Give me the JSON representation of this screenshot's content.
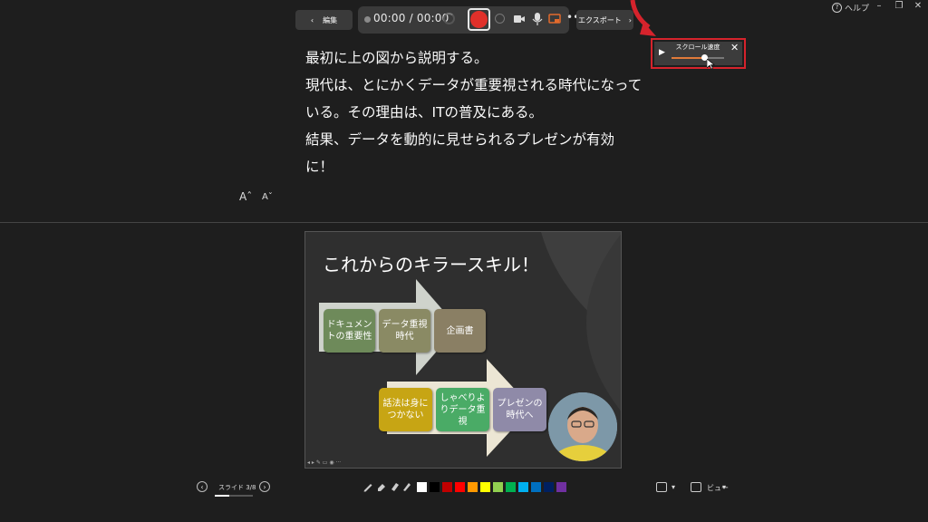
{
  "window": {
    "help_label": "ヘルプ",
    "minimize": "–",
    "restore": "❐",
    "close": "✕"
  },
  "toolbar": {
    "edit_label": "編集",
    "timer": "00:00 / 00:00",
    "export_label": "エクスポート",
    "more": "•••"
  },
  "script": {
    "lines": [
      "最初に上の図から説明する。",
      "現代は、とにかくデータが重要視される時代になって",
      "いる。その理由は、ITの普及にある。",
      "結果、データを動的に見せられるプレゼンが有効",
      "に！"
    ],
    "font_increase": "Aˆ",
    "font_decrease": "Aˇ"
  },
  "scroll_speed": {
    "label": "スクロール速度",
    "play": "▶",
    "close": "✕",
    "level": 0.62,
    "highlight_color": "#d6232c"
  },
  "slide": {
    "title": "これからのキラースキル！",
    "row1": [
      "ドキュメントの重要性",
      "データ重視時代",
      "企画書"
    ],
    "row2": [
      "話法は身につかない",
      "しゃべりよりデータ重視",
      "プレゼンの時代へ"
    ]
  },
  "bottom": {
    "slide_counter": "スライド 3/8",
    "progress": 0.375,
    "prev": "‹",
    "next": "›",
    "view_label": "ビュー",
    "caret": "▾",
    "colors": [
      "#ffffff",
      "#000000",
      "#c00000",
      "#ff0000",
      "#ff9900",
      "#ffff00",
      "#92d050",
      "#00b050",
      "#00b0f0",
      "#0070c0",
      "#002060",
      "#7030a0"
    ]
  }
}
